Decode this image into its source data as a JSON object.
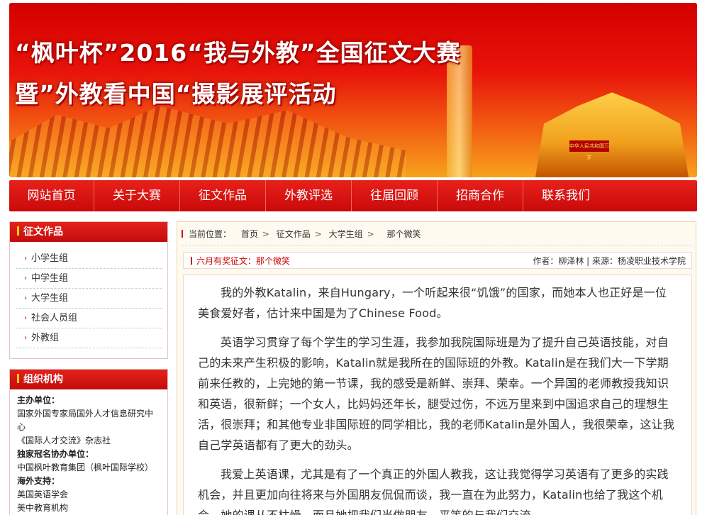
{
  "banner": {
    "line1": "“枫叶杯”2016“我与外教”全国征文大赛",
    "line2": "暨”外教看中国“摄影展评活动",
    "gate_sign": "中华人民共和国万岁"
  },
  "nav": [
    "网站首页",
    "关于大赛",
    "征文作品",
    "外教评选",
    "往届回顾",
    "招商合作",
    "联系我们"
  ],
  "sidebar": {
    "works_title": "征文作品",
    "categories": [
      "小学生组",
      "中学生组",
      "大学生组",
      "社会人员组",
      "外教组"
    ],
    "org_title": "组织机构",
    "org_lines": [
      {
        "text": "主办单位：",
        "bold": true
      },
      {
        "text": "国家外国专家局国外人才信息研究中心",
        "bold": false
      },
      {
        "text": "《国际人才交流》杂志社",
        "bold": false
      },
      {
        "text": "独家冠名协办单位：",
        "bold": true
      },
      {
        "text": "中国枫叶教育集团（枫叶国际学校）",
        "bold": false
      },
      {
        "text": "海外支持：",
        "bold": true
      },
      {
        "text": "美国英语学会",
        "bold": false
      },
      {
        "text": "美中教育机构",
        "bold": false
      }
    ]
  },
  "breadcrumb": {
    "label": "当前位置：",
    "items": [
      "首页",
      "征文作品",
      "大学生组",
      "那个微笑"
    ]
  },
  "article": {
    "title": "六月有奖征文：那个微笑",
    "meta": "作者：柳泽林 | 来源：杨凌职业技术学院",
    "paragraphs": [
      "我的外教Katalin，来自Hungary，一个听起来很“饥饿”的国家，而她本人也正好是一位美食爱好者，估计来中国是为了Chinese Food。",
      "英语学习贯穿了每个学生的学习生涯，我参加我院国际班是为了提升自己英语技能，对自己的未来产生积极的影响，Katalin就是我所在的国际班的外教。Katalin是在我们大一下学期前来任教的，上完她的第一节课，我的感受是新鲜、崇拜、荣幸。一个异国的老师教授我知识和英语，很新鲜；一个女人，比妈妈还年长，腿受过伤，不远万里来到中国追求自己的理想生活，很崇拜；和其他专业非国际班的同学相比，我的老师Katalin是外国人，我很荣幸，这让我自己学英语都有了更大的劲头。",
      "我爱上英语课，尤其是有了一个真正的外国人教我，这让我觉得学习英语有了更多的实践机会，并且更加向往将来与外国朋友侃侃而谈，我一直在为此努力，Katalin也给了我这个机会，她的课从不枯燥，而且她把我们当做朋友，平等的与我们交流。"
    ]
  },
  "colors": {
    "primary_red": "#d40000",
    "accent_yellow": "#ffd200"
  }
}
